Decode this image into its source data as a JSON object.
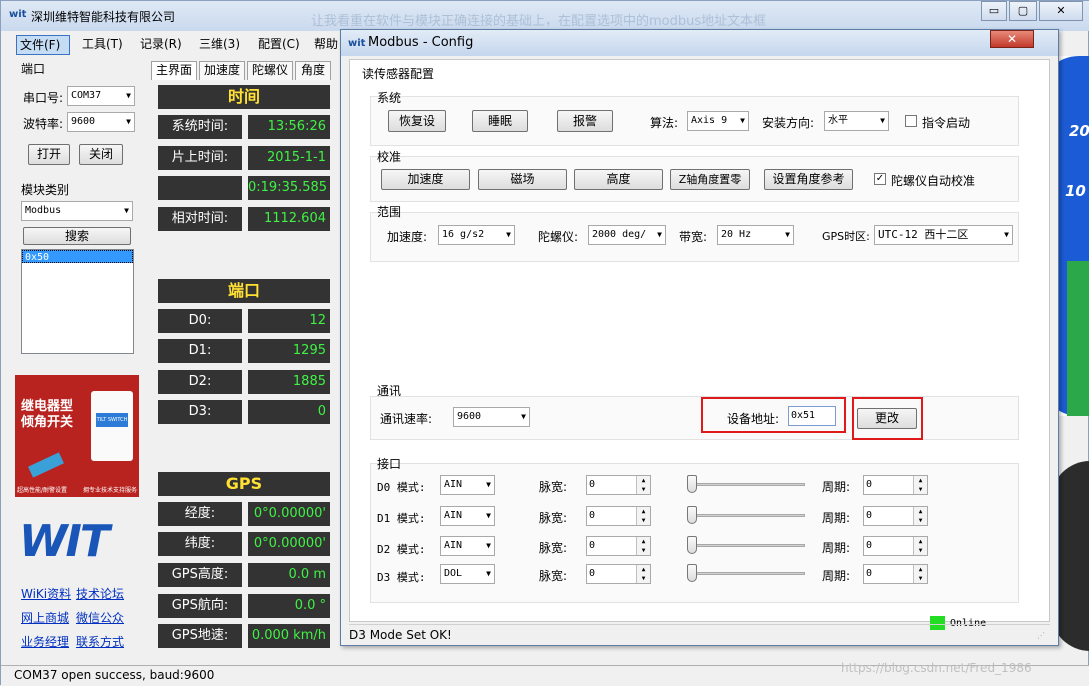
{
  "main_window": {
    "title": "深圳维特智能科技有限公司",
    "background_watermark": "让我看重在软件与模块正确连接的基础上，在配置选项中的modbus地址文本框",
    "controls": {
      "minimize": "▭",
      "maximize": "▢",
      "close": "✕"
    },
    "menu": [
      "文件(F)",
      "工具(T)",
      "记录(R)",
      "三维(3)",
      "配置(C)",
      "帮助"
    ]
  },
  "port_group": {
    "label": "端口",
    "port_label": "串口号:",
    "port_value": "COM37",
    "baud_label": "波特率:",
    "baud_value": "9600",
    "open_label": "打开",
    "close_label": "关闭"
  },
  "module_group": {
    "label": "模块类别",
    "type_value": "Modbus",
    "search_label": "搜索",
    "list_items": [
      "0x50"
    ]
  },
  "ad": {
    "line1": "继电器型",
    "line2": "倾角开关",
    "tag": "TILT SWITCH",
    "foot_left": "超高性能/耐警设置",
    "foot_right": "拥专业技术支持服务"
  },
  "logo_text": "WIT",
  "links": [
    "WiKi资料",
    "技术论坛",
    "网上商城",
    "微信公众",
    "业务经理",
    "联系方式"
  ],
  "status_text": "COM37 open success, baud:9600",
  "tabs": [
    "主界面",
    "加速度",
    "陀螺仪",
    "角度"
  ],
  "time_panel": {
    "header": "时间",
    "rows": [
      {
        "label": "系统时间:",
        "value": "13:56:26"
      },
      {
        "label": "片上时间:",
        "value": "2015-1-1"
      },
      {
        "label": "",
        "value": "0:19:35.585"
      },
      {
        "label": "相对时间:",
        "value": "1112.604"
      }
    ]
  },
  "port_panel": {
    "header": "端口",
    "rows": [
      {
        "label": "D0:",
        "value": "12"
      },
      {
        "label": "D1:",
        "value": "1295"
      },
      {
        "label": "D2:",
        "value": "1885"
      },
      {
        "label": "D3:",
        "value": "0"
      }
    ]
  },
  "gps_panel": {
    "header": "GPS",
    "rows": [
      {
        "label": "经度:",
        "value": "0°0.00000'"
      },
      {
        "label": "纬度:",
        "value": "0°0.00000'"
      },
      {
        "label": "GPS高度:",
        "value": "0.0 m"
      },
      {
        "label": "GPS航向:",
        "value": "0.0 °"
      },
      {
        "label": "GPS地速:",
        "value": "0.000 km/h"
      }
    ]
  },
  "gauge_numbers": [
    "20",
    "10"
  ],
  "dialog": {
    "title": "Modbus - Config",
    "close_glyph": "✕",
    "tab": "读传感器配置",
    "system": {
      "title": "系统",
      "restore": "恢复设",
      "sleep": "睡眠",
      "alarm": "报警",
      "algo_label": "算法:",
      "algo_value": "Axis 9",
      "install_label": "安装方向:",
      "install_value": "水平",
      "cmd_start": "指令启动"
    },
    "calibration": {
      "title": "校准",
      "accel": "加速度",
      "mag": "磁场",
      "height": "高度",
      "z_zero": "Z轴角度置零",
      "angle_ref": "设置角度参考",
      "gyro_auto": "陀螺仪自动校准"
    },
    "range": {
      "title": "范围",
      "accel_label": "加速度:",
      "accel_value": "16 g/s2",
      "gyro_label": "陀螺仪:",
      "gyro_value": "2000 deg/",
      "bw_label": "带宽:",
      "bw_value": "20  Hz",
      "tz_label": "GPS时区:",
      "tz_value": "UTC-12 西十二区"
    },
    "comm": {
      "title": "通讯",
      "rate_label": "通讯速率:",
      "rate_value": "9600",
      "addr_label": "设备地址:",
      "addr_value": "0x51",
      "change": "更改"
    },
    "interface": {
      "title": "接口",
      "mode_suffix": " 模式:",
      "pulse_label": "脉宽:",
      "period_label": "周期:",
      "rows": [
        {
          "name": "D0",
          "mode": "AIN",
          "pulse": "0",
          "period": "0"
        },
        {
          "name": "D1",
          "mode": "AIN",
          "pulse": "0",
          "period": "0"
        },
        {
          "name": "D2",
          "mode": "AIN",
          "pulse": "0",
          "period": "0"
        },
        {
          "name": "D3",
          "mode": "DOL",
          "pulse": "0",
          "period": "0"
        }
      ]
    },
    "online": "Online",
    "status": "D3 Mode Set OK!"
  },
  "watermark": "https://blog.csdn.net/Fred_1986",
  "colors": {
    "accent": "#3ff244",
    "header_text": "#ffe033",
    "panel_bg": "#333333",
    "highlight": "#e01a1a",
    "online": "#22dd22"
  },
  "icons": {
    "app": "wit-logo-icon",
    "dropdown": "chevron-down-icon",
    "check": "checkmark-icon"
  }
}
